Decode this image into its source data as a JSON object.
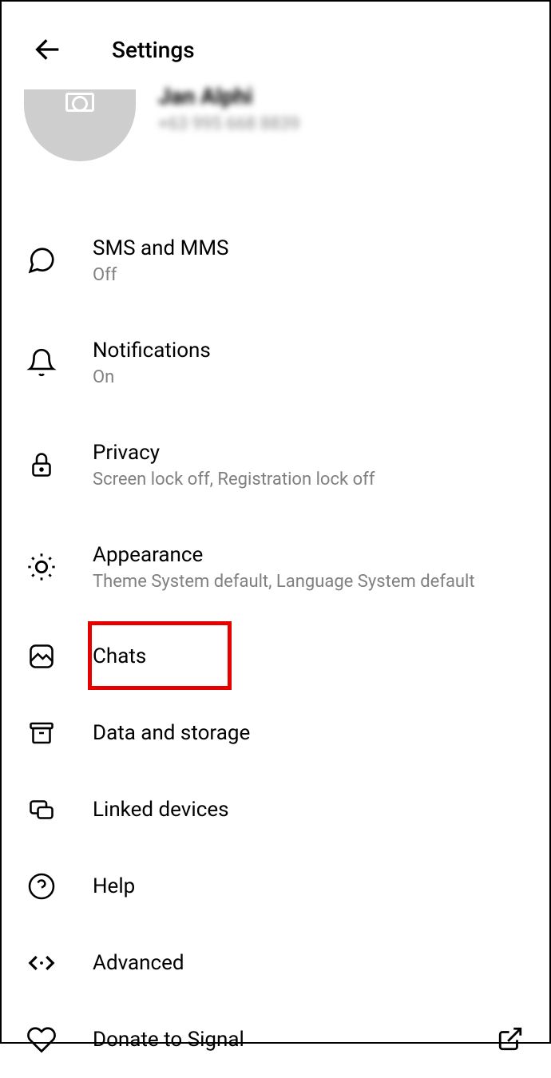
{
  "header": {
    "title": "Settings"
  },
  "profile": {
    "name": "Jan Alphi",
    "phone": "+63 995 668 8839"
  },
  "settings": {
    "sms_mms": {
      "title": "SMS and MMS",
      "subtitle": "Off"
    },
    "notifications": {
      "title": "Notifications",
      "subtitle": "On"
    },
    "privacy": {
      "title": "Privacy",
      "subtitle": "Screen lock off, Registration lock off"
    },
    "appearance": {
      "title": "Appearance",
      "subtitle": "Theme System default, Language System default"
    },
    "chats": {
      "title": "Chats"
    },
    "data_storage": {
      "title": "Data and storage"
    },
    "linked_devices": {
      "title": "Linked devices"
    },
    "help": {
      "title": "Help"
    },
    "advanced": {
      "title": "Advanced"
    },
    "donate": {
      "title": "Donate to Signal"
    }
  }
}
